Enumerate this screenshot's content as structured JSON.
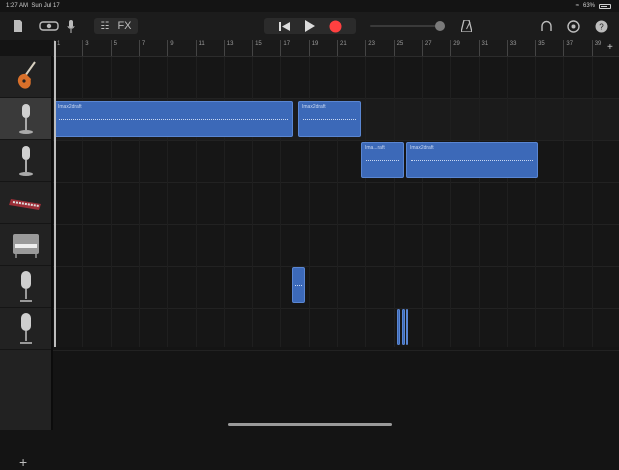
{
  "status_bar": {
    "time": "1:27 AM",
    "date": "Sun Jul 17",
    "battery": "63%"
  },
  "toolbar": {
    "fx_label": "FX"
  },
  "ruler": {
    "bars": [
      "1",
      "3",
      "5",
      "7",
      "9",
      "11",
      "13",
      "15",
      "17",
      "19",
      "21",
      "23",
      "25",
      "27",
      "29",
      "31",
      "33",
      "35",
      "37",
      "39"
    ]
  },
  "tracks": [
    {
      "name": "guitar",
      "icon": "electric-guitar-icon"
    },
    {
      "name": "mic-1",
      "icon": "microphone-icon",
      "selected": true
    },
    {
      "name": "mic-2",
      "icon": "microphone-icon"
    },
    {
      "name": "synth",
      "icon": "keyboard-icon"
    },
    {
      "name": "piano",
      "icon": "upright-piano-icon"
    },
    {
      "name": "mic-3",
      "icon": "condenser-mic-icon"
    },
    {
      "name": "mic-4",
      "icon": "condenser-mic-icon"
    }
  ],
  "regions": [
    {
      "track": 1,
      "label": "Imax2draft"
    },
    {
      "track": 1,
      "label": "Imax2draft"
    },
    {
      "track": 2,
      "label": "Ima...raft"
    },
    {
      "track": 2,
      "label": "Imax2draft"
    },
    {
      "track": 5,
      "label": ""
    },
    {
      "track": 6,
      "label": ""
    }
  ],
  "colors": {
    "region": "#3c69b8",
    "record": "#ff4040"
  }
}
